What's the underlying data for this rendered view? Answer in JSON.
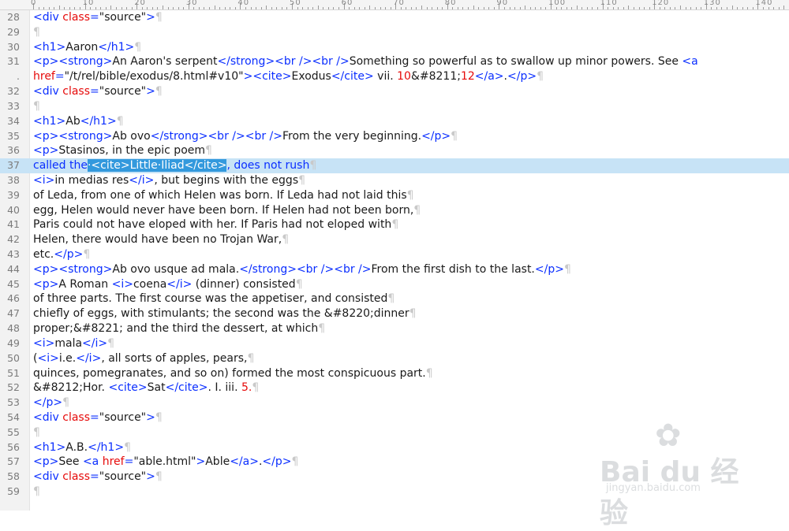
{
  "ruler": {
    "labels": [
      "0",
      "10",
      "20",
      "30",
      "40",
      "50",
      "60",
      "70",
      "80",
      "90",
      "100",
      "110",
      "120",
      "130",
      "140"
    ]
  },
  "lines": [
    {
      "num": "28",
      "seg": [
        [
          "tag",
          "<div "
        ],
        [
          "attr",
          "class"
        ],
        [
          "tag",
          "="
        ],
        [
          "str",
          "\"source\""
        ],
        [
          "tag",
          ">"
        ],
        [
          "pil",
          "¶"
        ]
      ]
    },
    {
      "num": "29",
      "seg": [
        [
          "pil",
          "¶"
        ]
      ]
    },
    {
      "num": "30",
      "seg": [
        [
          "tag",
          "<h1>"
        ],
        [
          "str",
          "Aaron"
        ],
        [
          "tag",
          "</h1>"
        ],
        [
          "pil",
          "¶"
        ]
      ]
    },
    {
      "num": "31",
      "seg": [
        [
          "tag",
          "<p><strong>"
        ],
        [
          "str",
          "An Aaron's serpent"
        ],
        [
          "tag",
          "</strong><br /><br />"
        ],
        [
          "str",
          "Something so powerful as to swallow up minor powers. See "
        ],
        [
          "tag",
          "<a"
        ]
      ]
    },
    {
      "num": ".",
      "seg": [
        [
          "attr",
          "href"
        ],
        [
          "tag",
          "="
        ],
        [
          "str",
          "\"/t/rel/bible/exodus/8.html#v10\""
        ],
        [
          "tag",
          "><cite>"
        ],
        [
          "str",
          "Exodus"
        ],
        [
          "tag",
          "</cite>"
        ],
        [
          "str",
          " vii. "
        ],
        [
          "num",
          "10"
        ],
        [
          "str",
          "&#8211;"
        ],
        [
          "num",
          "12"
        ],
        [
          "tag",
          "</a>"
        ],
        [
          "str",
          "."
        ],
        [
          "tag",
          "</p>"
        ],
        [
          "pil",
          "¶"
        ]
      ]
    },
    {
      "num": "32",
      "seg": [
        [
          "tag",
          "<div "
        ],
        [
          "attr",
          "class"
        ],
        [
          "tag",
          "="
        ],
        [
          "str",
          "\"source\""
        ],
        [
          "tag",
          ">"
        ],
        [
          "pil",
          "¶"
        ]
      ]
    },
    {
      "num": "33",
      "seg": [
        [
          "pil",
          "¶"
        ]
      ]
    },
    {
      "num": "34",
      "seg": [
        [
          "tag",
          "<h1>"
        ],
        [
          "str",
          "Ab"
        ],
        [
          "tag",
          "</h1>"
        ],
        [
          "pil",
          "¶"
        ]
      ]
    },
    {
      "num": "35",
      "seg": [
        [
          "tag",
          "<p><strong>"
        ],
        [
          "str",
          "Ab ovo"
        ],
        [
          "tag",
          "</strong><br /><br />"
        ],
        [
          "str",
          "From the very beginning."
        ],
        [
          "tag",
          "</p>"
        ],
        [
          "pil",
          "¶"
        ]
      ]
    },
    {
      "num": "36",
      "seg": [
        [
          "tag",
          "<p>"
        ],
        [
          "str",
          "Stasinos, in the epic poem"
        ],
        [
          "pil",
          "¶"
        ]
      ]
    },
    {
      "num": "37",
      "sel": true,
      "seg": [
        [
          "tag",
          "called the"
        ],
        [
          "hl",
          "·<cite>Little·Iliad</cite>"
        ],
        [
          "tag",
          ", does not rush"
        ],
        [
          "pil",
          "¶"
        ]
      ]
    },
    {
      "num": "38",
      "seg": [
        [
          "tag",
          "<i>"
        ],
        [
          "str",
          "in medias res"
        ],
        [
          "tag",
          "</i>"
        ],
        [
          "str",
          ", but begins with the eggs"
        ],
        [
          "pil",
          "¶"
        ]
      ]
    },
    {
      "num": "39",
      "seg": [
        [
          "str",
          "of Leda, from one of which Helen was born. If Leda had not laid this"
        ],
        [
          "pil",
          "¶"
        ]
      ]
    },
    {
      "num": "40",
      "seg": [
        [
          "str",
          "egg, Helen would never have been born. If Helen had not been born,"
        ],
        [
          "pil",
          "¶"
        ]
      ]
    },
    {
      "num": "41",
      "seg": [
        [
          "str",
          "Paris could not have eloped with her. If Paris had not eloped with"
        ],
        [
          "pil",
          "¶"
        ]
      ]
    },
    {
      "num": "42",
      "seg": [
        [
          "str",
          "Helen, there would have been no Trojan War,"
        ],
        [
          "pil",
          "¶"
        ]
      ]
    },
    {
      "num": "43",
      "seg": [
        [
          "str",
          "etc."
        ],
        [
          "tag",
          "</p>"
        ],
        [
          "pil",
          "¶"
        ]
      ]
    },
    {
      "num": "44",
      "seg": [
        [
          "tag",
          "<p><strong>"
        ],
        [
          "str",
          "Ab ovo usque ad mala."
        ],
        [
          "tag",
          "</strong><br /><br />"
        ],
        [
          "str",
          "From the first dish to the last."
        ],
        [
          "tag",
          "</p>"
        ],
        [
          "pil",
          "¶"
        ]
      ]
    },
    {
      "num": "45",
      "seg": [
        [
          "tag",
          "<p>"
        ],
        [
          "str",
          "A Roman "
        ],
        [
          "tag",
          "<i>"
        ],
        [
          "str",
          "coena"
        ],
        [
          "tag",
          "</i>"
        ],
        [
          "str",
          " (dinner) consisted"
        ],
        [
          "pil",
          "¶"
        ]
      ]
    },
    {
      "num": "46",
      "seg": [
        [
          "str",
          "of three parts. The first course was the appetiser, and consisted"
        ],
        [
          "pil",
          "¶"
        ]
      ]
    },
    {
      "num": "47",
      "seg": [
        [
          "str",
          "chiefly of eggs, with stimulants; the second was the &#8220;dinner"
        ],
        [
          "pil",
          "¶"
        ]
      ]
    },
    {
      "num": "48",
      "seg": [
        [
          "str",
          "proper;&#8221; and the third the dessert, at which"
        ],
        [
          "pil",
          "¶"
        ]
      ]
    },
    {
      "num": "49",
      "seg": [
        [
          "tag",
          "<i>"
        ],
        [
          "str",
          "mala"
        ],
        [
          "tag",
          "</i>"
        ],
        [
          "pil",
          "¶"
        ]
      ]
    },
    {
      "num": "50",
      "seg": [
        [
          "str",
          "("
        ],
        [
          "tag",
          "<i>"
        ],
        [
          "str",
          "i.e."
        ],
        [
          "tag",
          "</i>"
        ],
        [
          "str",
          ", all sorts of apples, pears,"
        ],
        [
          "pil",
          "¶"
        ]
      ]
    },
    {
      "num": "51",
      "seg": [
        [
          "str",
          "quinces, pomegranates, and so on) formed the most conspicuous part."
        ],
        [
          "pil",
          "¶"
        ]
      ]
    },
    {
      "num": "52",
      "seg": [
        [
          "str",
          "&#8212;Hor. "
        ],
        [
          "tag",
          "<cite>"
        ],
        [
          "str",
          "Sat"
        ],
        [
          "tag",
          "</cite>"
        ],
        [
          "str",
          ". I. iii. "
        ],
        [
          "num",
          "5."
        ],
        [
          "pil",
          "¶"
        ]
      ]
    },
    {
      "num": "53",
      "seg": [
        [
          "tag",
          "</p>"
        ],
        [
          "pil",
          "¶"
        ]
      ]
    },
    {
      "num": "54",
      "seg": [
        [
          "tag",
          "<div "
        ],
        [
          "attr",
          "class"
        ],
        [
          "tag",
          "="
        ],
        [
          "str",
          "\"source\""
        ],
        [
          "tag",
          ">"
        ],
        [
          "pil",
          "¶"
        ]
      ]
    },
    {
      "num": "55",
      "seg": [
        [
          "pil",
          "¶"
        ]
      ]
    },
    {
      "num": "56",
      "seg": [
        [
          "tag",
          "<h1>"
        ],
        [
          "str",
          "A.B."
        ],
        [
          "tag",
          "</h1>"
        ],
        [
          "pil",
          "¶"
        ]
      ]
    },
    {
      "num": "57",
      "seg": [
        [
          "tag",
          "<p>"
        ],
        [
          "str",
          "See "
        ],
        [
          "tag",
          "<a "
        ],
        [
          "attr",
          "href"
        ],
        [
          "tag",
          "="
        ],
        [
          "str",
          "\"able.html\""
        ],
        [
          "tag",
          ">"
        ],
        [
          "str",
          "Able"
        ],
        [
          "tag",
          "</a>"
        ],
        [
          "str",
          "."
        ],
        [
          "tag",
          "</p>"
        ],
        [
          "pil",
          "¶"
        ]
      ]
    },
    {
      "num": "58",
      "seg": [
        [
          "tag",
          "<div "
        ],
        [
          "attr",
          "class"
        ],
        [
          "tag",
          "="
        ],
        [
          "str",
          "\"source\""
        ],
        [
          "tag",
          ">"
        ],
        [
          "pil",
          "¶"
        ]
      ]
    },
    {
      "num": "59",
      "seg": [
        [
          "pil",
          "¶"
        ]
      ]
    }
  ],
  "watermark": {
    "brand": "Bai du 经验",
    "url": "jingyan.baidu.com",
    "paw_icon": "baidu-paw-icon"
  }
}
